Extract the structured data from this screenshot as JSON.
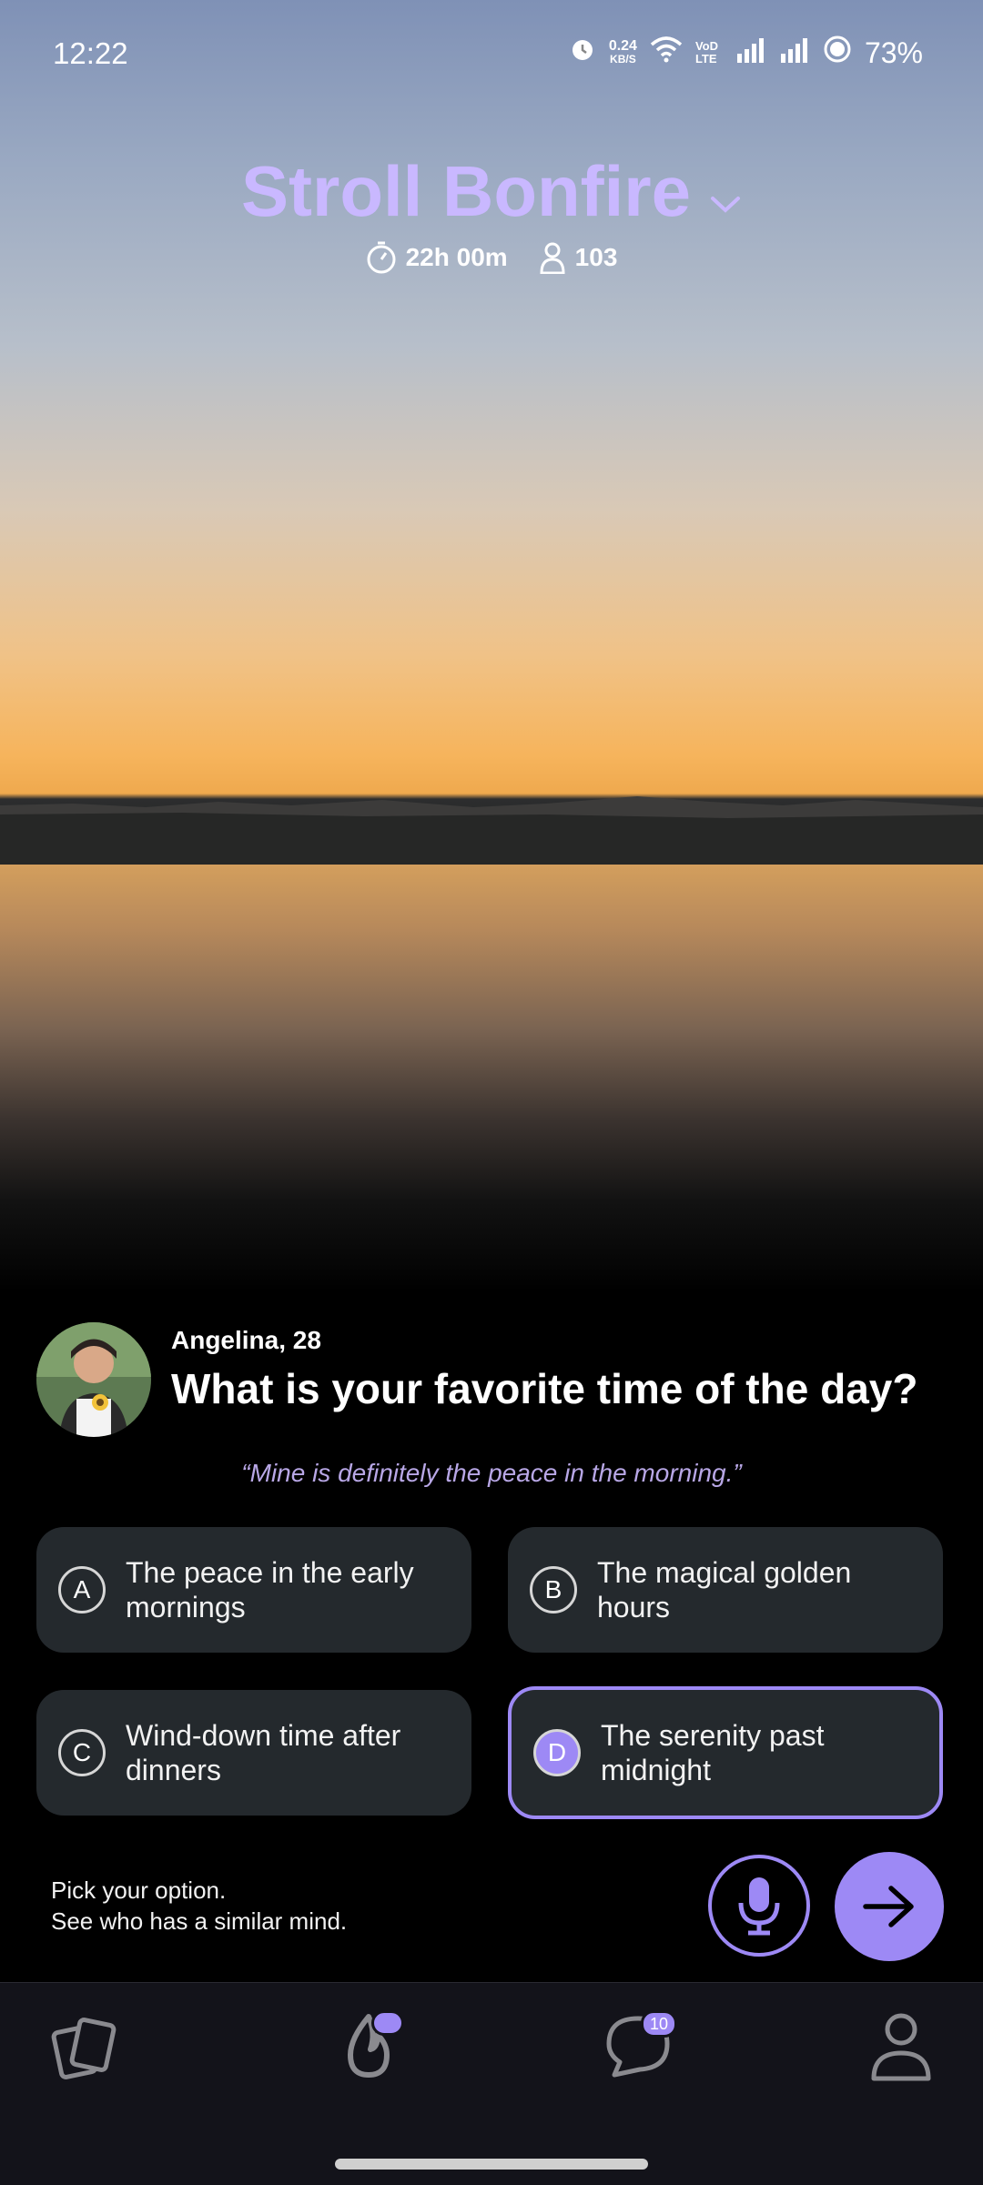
{
  "status_bar": {
    "time": "12:22",
    "net_speed": "0.24",
    "net_unit": "KB/S",
    "volte": "VoD LTE",
    "battery": "73%"
  },
  "header": {
    "title": "Stroll Bonfire",
    "timer": "22h 00m",
    "participants": "103"
  },
  "card": {
    "name": "Angelina, 28",
    "question": "What is your favorite time of the day?",
    "quote": "“Mine is definitely the peace in the morning.”"
  },
  "options": [
    {
      "letter": "A",
      "text": "The peace in the early mornings"
    },
    {
      "letter": "B",
      "text": "The magical golden hours"
    },
    {
      "letter": "C",
      "text": "Wind-down time after dinners"
    },
    {
      "letter": "D",
      "text": "The serenity past midnight"
    }
  ],
  "footer": {
    "hint_line1": "Pick your option.",
    "hint_line2": "See who has a similar mind."
  },
  "nav": {
    "chat_badge": "10"
  },
  "colors": {
    "accent": "#9d89f5",
    "title": "#c9b8ff",
    "option_bg": "#24292d"
  }
}
